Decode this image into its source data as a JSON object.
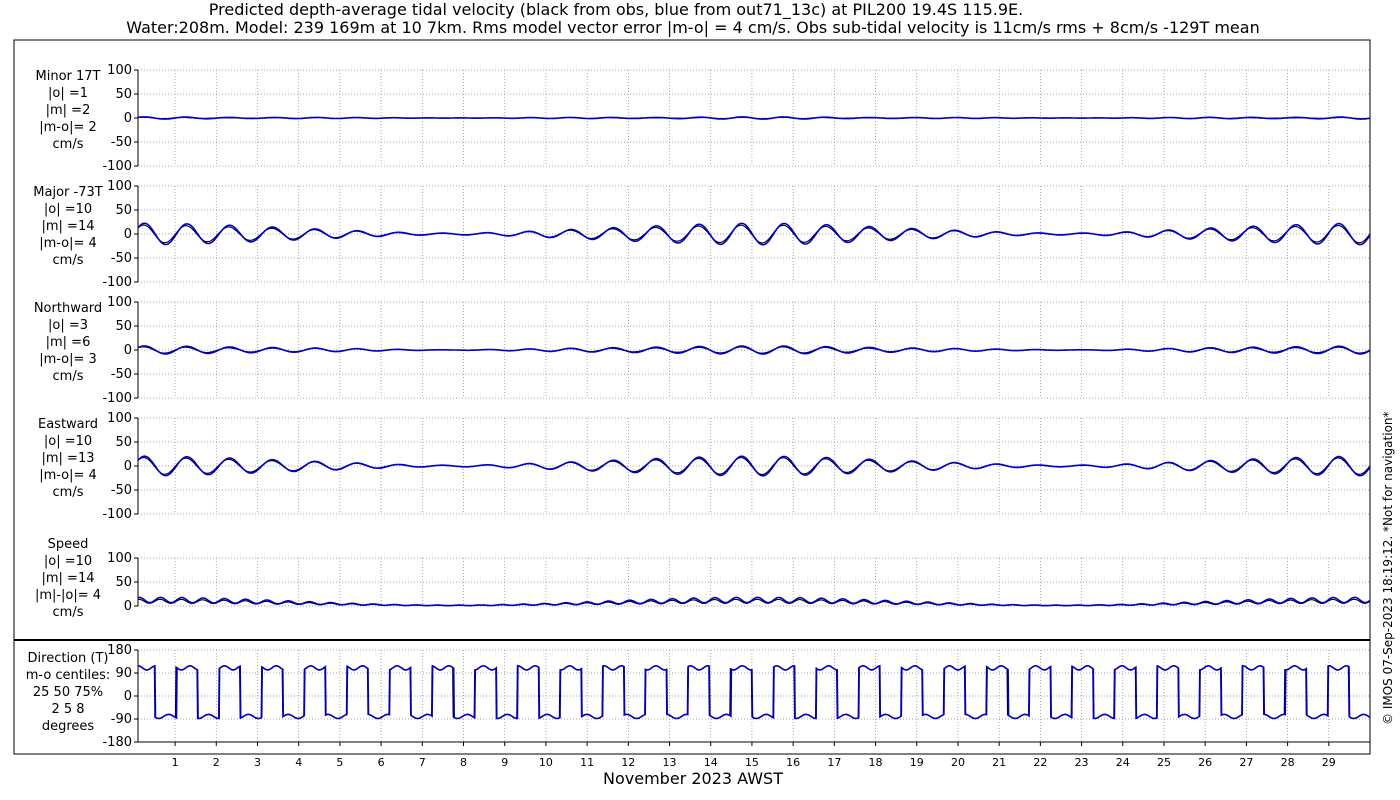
{
  "title_line1": "Predicted depth-average tidal velocity (black from obs, blue from out71_13c) at PIL200 19.4S 115.9E.",
  "title_line2": "Water:208m. Model: 239 169m at 10 7km. Rms model vector error |m-o| = 4 cm/s. Obs sub-tidal velocity is 11cm/s rms + 8cm/s -129T mean",
  "xlabel": "November 2023 AWST",
  "credit": "© IMOS 07-Sep-2023 18:19:12. *Not for navigation*",
  "colors": {
    "obs": "#000000",
    "model": "#0000cc",
    "grid": "#888888",
    "axis": "#000000"
  },
  "chart_data": {
    "type": "line",
    "x_unit": "day of November 2023",
    "xlim": [
      0.1,
      30.0
    ],
    "x_ticks": [
      1,
      2,
      3,
      4,
      5,
      6,
      7,
      8,
      9,
      10,
      11,
      12,
      13,
      14,
      15,
      16,
      17,
      18,
      19,
      20,
      21,
      22,
      23,
      24,
      25,
      26,
      27,
      28,
      29
    ],
    "x_tick_labels": [
      "1",
      "2",
      "3",
      "4",
      "5",
      "6",
      "7",
      "8",
      "9",
      "10",
      "11",
      "12",
      "13",
      "14",
      "15",
      "16",
      "17",
      "18",
      "19",
      "20",
      "21",
      "22",
      "23",
      "24",
      "25",
      "26",
      "27",
      "28",
      "29"
    ],
    "grid": "dotted",
    "series_names": [
      "obs",
      "model"
    ],
    "panels": [
      {
        "key": "minor",
        "label_lines": [
          "Minor 17T",
          "|o| =1",
          "|m| =2",
          "|m-o|= 2",
          "cm/s"
        ],
        "ylim": [
          -100,
          100
        ],
        "y_ticks": [
          100,
          50,
          0,
          -50,
          -100
        ],
        "y_tick_labels": [
          "100",
          "50",
          "0",
          "-50",
          "-100"
        ],
        "obs_amp": 1,
        "model_amp": 2,
        "offset": 0,
        "kind": "signed"
      },
      {
        "key": "major",
        "label_lines": [
          "Major -73T",
          "|o| =10",
          "|m| =14",
          "|m-o|= 4",
          "cm/s"
        ],
        "ylim": [
          -100,
          100
        ],
        "y_ticks": [
          100,
          50,
          0,
          -50,
          -100
        ],
        "y_tick_labels": [
          "100",
          "50",
          "0",
          "-50",
          "-100"
        ],
        "obs_amp": 18,
        "model_amp": 22,
        "offset": 0,
        "kind": "signed"
      },
      {
        "key": "north",
        "label_lines": [
          "Northward",
          "|o| =3",
          "|m| =6",
          "|m-o|= 3",
          "cm/s"
        ],
        "ylim": [
          -100,
          100
        ],
        "y_ticks": [
          100,
          50,
          0,
          -50,
          -100
        ],
        "y_tick_labels": [
          "100",
          "50",
          "0",
          "-50",
          "-100"
        ],
        "obs_amp": 6,
        "model_amp": 8,
        "offset": 0,
        "kind": "signed"
      },
      {
        "key": "east",
        "label_lines": [
          "Eastward",
          "|o| =10",
          "|m| =13",
          "|m-o|= 4",
          "cm/s"
        ],
        "ylim": [
          -100,
          100
        ],
        "y_ticks": [
          100,
          50,
          0,
          -50,
          -100
        ],
        "y_tick_labels": [
          "100",
          "50",
          "0",
          "-50",
          "-100"
        ],
        "obs_amp": 17,
        "model_amp": 20,
        "offset": 0,
        "kind": "signed"
      },
      {
        "key": "speed",
        "label_lines": [
          "Speed",
          "|o| =10",
          "|m| =14",
          "|m|-|o|= 4",
          "cm/s"
        ],
        "ylim": [
          0,
          100
        ],
        "y_ticks": [
          100,
          50,
          0
        ],
        "y_tick_labels": [
          "100",
          "50",
          "0"
        ],
        "obs_amp": 14,
        "model_amp": 18,
        "offset": 0,
        "kind": "speed"
      },
      {
        "key": "direction",
        "label_lines": [
          "Direction (T)",
          "m-o centiles:",
          "25  50  75%",
          "2  5  8",
          "degrees"
        ],
        "ylim": [
          -180,
          180
        ],
        "y_ticks": [
          180,
          90,
          0,
          -90,
          -180
        ],
        "y_tick_labels": [
          "180",
          "90",
          "0",
          "-90",
          "-180"
        ],
        "obs_amp": 0,
        "model_amp": 0,
        "offset": 0,
        "kind": "direction"
      }
    ]
  }
}
